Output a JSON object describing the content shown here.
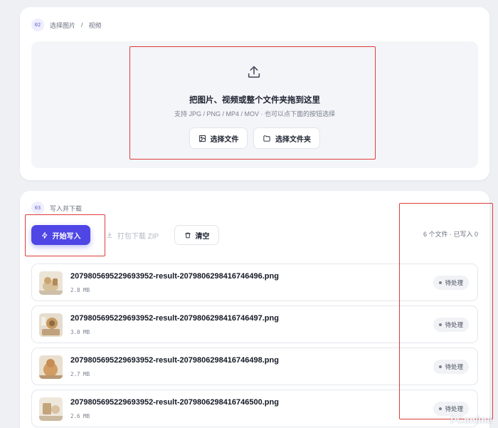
{
  "select_section": {
    "step": "02",
    "breadcrumb": [
      "选择图片",
      "/",
      "视频"
    ],
    "drop_title": "把图片、视频或整个文件夹拖到这里",
    "drop_subtitle": "支持 JPG / PNG / MP4 / MOV · 也可以点下面的按钮选择",
    "select_file_label": "选择文件",
    "select_folder_label": "选择文件夹",
    "icons": [
      "upload-icon",
      "image-icon",
      "folder-icon"
    ]
  },
  "write_section": {
    "step": "03",
    "title": "写入并下载",
    "start_label": "开始写入",
    "zip_label": "打包下载 ZIP",
    "clear_label": "清空",
    "summary": "6 个文件 · 已写入 0",
    "icons": [
      "bolt-icon",
      "download-icon",
      "trash-icon"
    ]
  },
  "files": [
    {
      "name": "2079805695229693952-result-2079806298416746496.png",
      "size": "2.8 MB",
      "status": "待处理"
    },
    {
      "name": "2079805695229693952-result-2079806298416746497.png",
      "size": "3.0 MB",
      "status": "待处理"
    },
    {
      "name": "2079805695229693952-result-2079806298416746498.png",
      "size": "2.7 MB",
      "status": "待处理"
    },
    {
      "name": "2079805695229693952-result-2079806298416746500.png",
      "size": "2.6 MB",
      "status": "待处理"
    }
  ],
  "watermark": "PConline",
  "colors": {
    "accent": "#4f46e5",
    "annotation": "#e03b3b",
    "background": "#eef0f4"
  }
}
